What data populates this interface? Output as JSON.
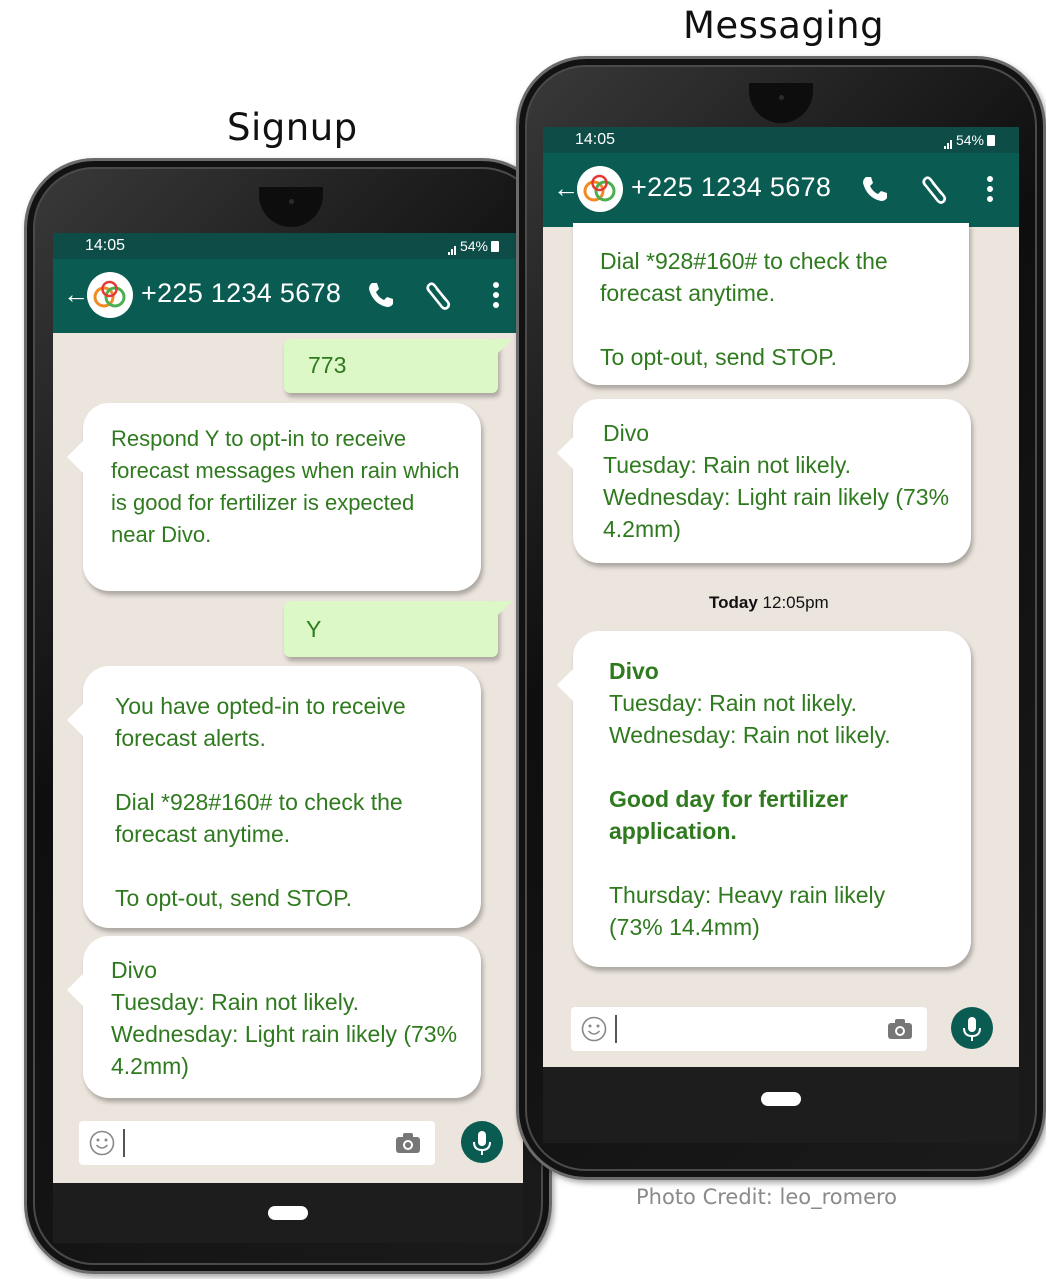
{
  "captions": {
    "signup": "Signup",
    "messaging": "Messaging"
  },
  "credit": "Photo Credit: leo_romero",
  "phones": {
    "signup": {
      "status_time": "14:05",
      "battery": "54%",
      "contact_number": "+225 1234 5678",
      "messages": [
        {
          "dir": "out",
          "text": "773"
        },
        {
          "dir": "in",
          "text": "Respond Y to opt-in to receive forecast messages when rain which is good for fertilizer is expected near Divo."
        },
        {
          "dir": "out",
          "text": "Y"
        },
        {
          "dir": "in",
          "text": "You have opted-in to receive forecast alerts.\n\nDial *928#160# to check the forecast anytime.\n\nTo opt-out, send STOP."
        },
        {
          "dir": "in",
          "text": "Divo\nTuesday: Rain not likely.\nWednesday: Light rain likely (73% 4.2mm)"
        }
      ]
    },
    "messaging": {
      "status_time": "14:05",
      "battery": "54%",
      "contact_number": "+225 1234 5678",
      "messages": [
        {
          "dir": "in",
          "text": "Dial *928#160# to check the forecast anytime.\n\nTo opt-out, send STOP."
        },
        {
          "dir": "in",
          "text": "Divo\nTuesday: Rain not likely.\nWednesday: Light rain likely (73% 4.2mm)"
        },
        {
          "dir": "in",
          "title": "Divo",
          "line1": "Tuesday: Rain not likely.",
          "line2": "Wednesday: Rain not likely.",
          "highlight": "Good day for fertilizer application.",
          "line3": "Thursday: Heavy rain likely (73% 14.4mm)"
        }
      ],
      "date_divider": {
        "day": "Today",
        "time": "12:05pm"
      }
    }
  },
  "colors": {
    "header": "#0a5c52",
    "statusbar": "#0e4d47",
    "chat_bg": "#ece5dd",
    "text_green": "#2f7a1f",
    "outgoing_bubble": "#dcf8c6"
  },
  "icons": {
    "back": "arrow-left-icon",
    "call": "phone-icon",
    "attach": "paperclip-icon",
    "menu": "more-vertical-icon",
    "emoji": "smiley-icon",
    "camera": "camera-icon",
    "mic": "microphone-icon"
  }
}
